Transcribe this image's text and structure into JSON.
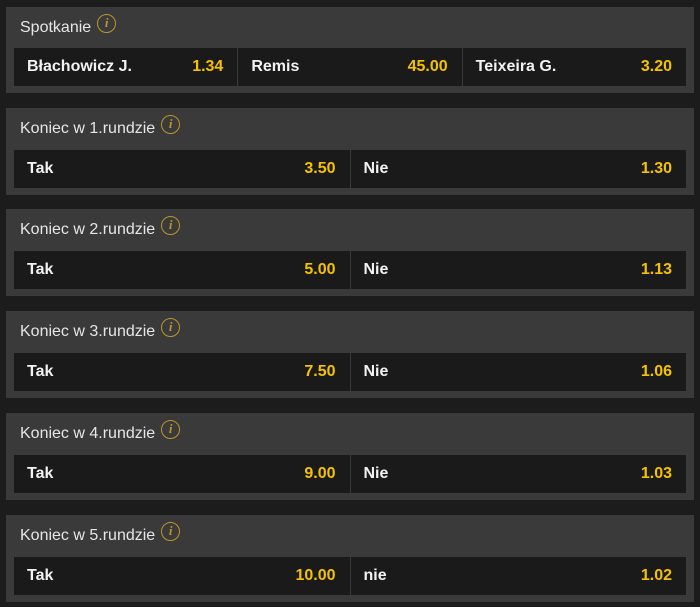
{
  "markets": [
    {
      "title": "Spotkanie",
      "outcomes": [
        {
          "name": "Błachowicz J.",
          "odds": "1.34"
        },
        {
          "name": "Remis",
          "odds": "45.00"
        },
        {
          "name": "Teixeira G.",
          "odds": "3.20"
        }
      ]
    },
    {
      "title": "Koniec w 1.rundzie",
      "outcomes": [
        {
          "name": "Tak",
          "odds": "3.50"
        },
        {
          "name": "Nie",
          "odds": "1.30"
        }
      ]
    },
    {
      "title": "Koniec w 2.rundzie",
      "outcomes": [
        {
          "name": "Tak",
          "odds": "5.00"
        },
        {
          "name": "Nie",
          "odds": "1.13"
        }
      ]
    },
    {
      "title": "Koniec w 3.rundzie",
      "outcomes": [
        {
          "name": "Tak",
          "odds": "7.50"
        },
        {
          "name": "Nie",
          "odds": "1.06"
        }
      ]
    },
    {
      "title": "Koniec w 4.rundzie",
      "outcomes": [
        {
          "name": "Tak",
          "odds": "9.00"
        },
        {
          "name": "Nie",
          "odds": "1.03"
        }
      ]
    },
    {
      "title": "Koniec w 5.rundzie",
      "outcomes": [
        {
          "name": "Tak",
          "odds": "10.00"
        },
        {
          "name": "nie",
          "odds": "1.02"
        }
      ]
    }
  ],
  "info_icon_glyph": "i",
  "colors": {
    "odds": "#f5c200",
    "info_icon": "#b8972a",
    "panel": "#3a3a3a",
    "row": "#1a1a1a"
  }
}
